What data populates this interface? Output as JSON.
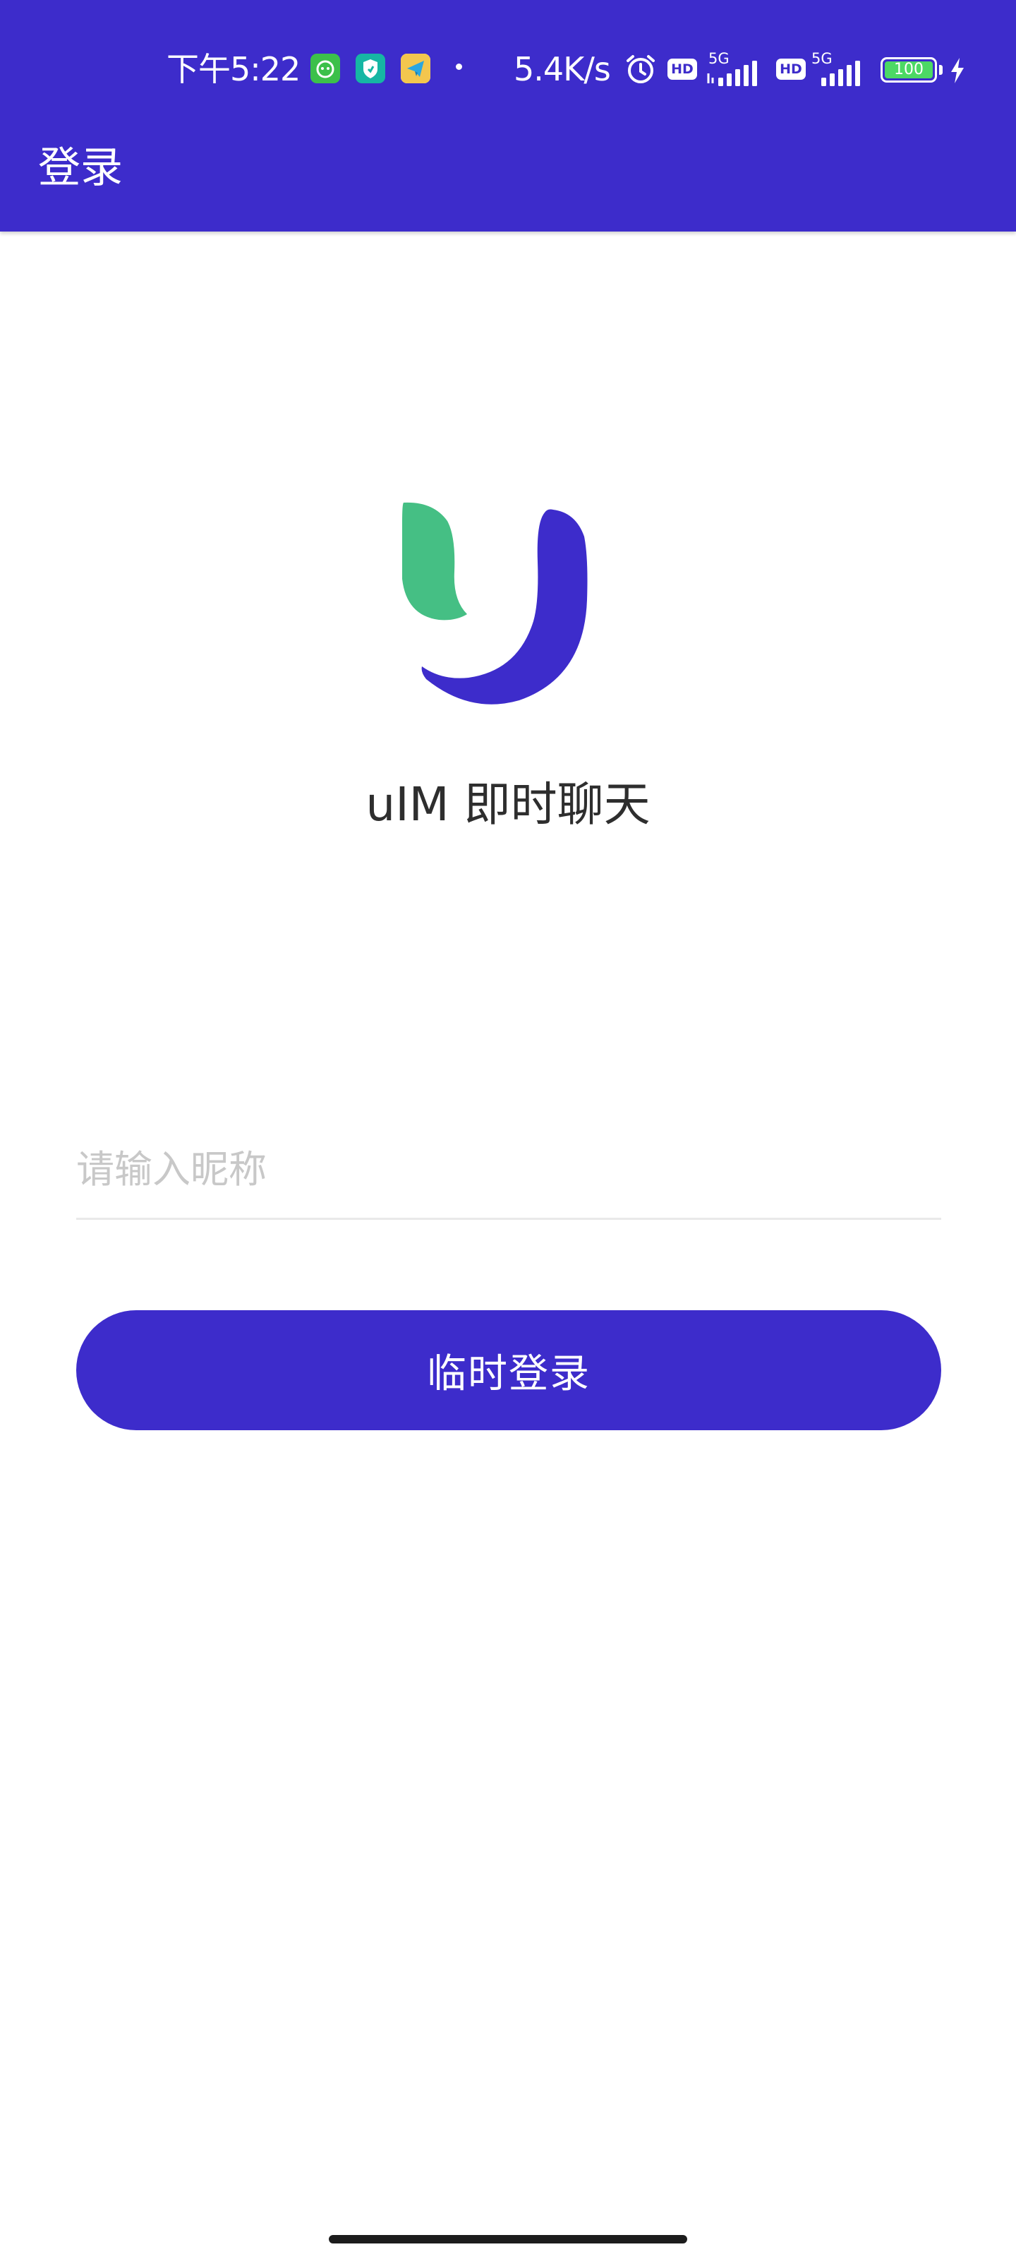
{
  "status_bar": {
    "time": "下午5:22",
    "network_speed": "5.4K/s",
    "hd_badge": "HD",
    "network_type": "5G",
    "battery_level": "100",
    "icons": [
      "app-icon-green",
      "app-icon-shield",
      "app-icon-telegram",
      "alarm-icon",
      "signal-icon",
      "charging-icon"
    ]
  },
  "app_bar": {
    "title": "登录"
  },
  "brand": {
    "app_name": "uIM 即时聊天",
    "logo": "uim-logo"
  },
  "form": {
    "nickname_value": "",
    "nickname_placeholder": "请输入昵称",
    "login_button_label": "临时登录"
  },
  "colors": {
    "primary": "#3d2ccb",
    "logo_green": "#45bf84",
    "background": "#ffffff",
    "text": "#2e2e2e",
    "placeholder": "#c8c8c8",
    "divider": "#e9e9e9"
  }
}
